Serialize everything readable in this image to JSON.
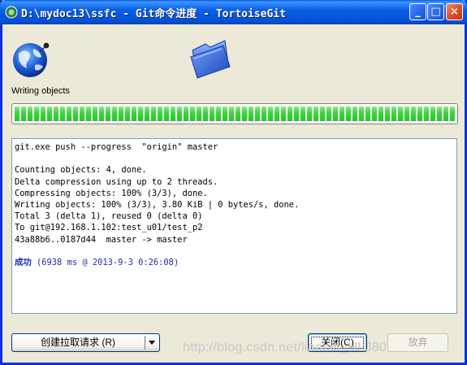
{
  "window": {
    "title": "D:\\mydoc13\\ssfc - Git命令进度 - TortoiseGit",
    "minimize_glyph": "_",
    "maximize_glyph": "□",
    "close_glyph": "×"
  },
  "icons": {
    "title": "tortoisegit-icon",
    "left": "globe-icon",
    "right": "folder-icon"
  },
  "status": "Writing objects",
  "progress_percent": 100,
  "log": {
    "lines": [
      "git.exe push --progress  \"origin\" master",
      "",
      "Counting objects: 4, done.",
      "Delta compression using up to 2 threads.",
      "Compressing objects: 100% (3/3), done.",
      "Writing objects: 100% (3/3), 3.80 KiB | 0 bytes/s, done.",
      "Total 3 (delta 1), reused 0 (delta 0)",
      "To git@192.168.1.102:test_u01/test_p2",
      "43a88b6..0187d44  master -> master",
      ""
    ],
    "success_word": "成功",
    "success_detail": " (6938 ms @ 2013-9-3 0:26:08)"
  },
  "buttons": {
    "pull_request": "创建拉取请求 (R)",
    "close": "关闭(C)",
    "abort": "放弃"
  },
  "watermark": "http://blog.csdn.net/liaobin_HLJ80",
  "colors": {
    "titlebar": "#0450d6",
    "progress": "#37d637",
    "success_text": "#1c2ea8"
  }
}
